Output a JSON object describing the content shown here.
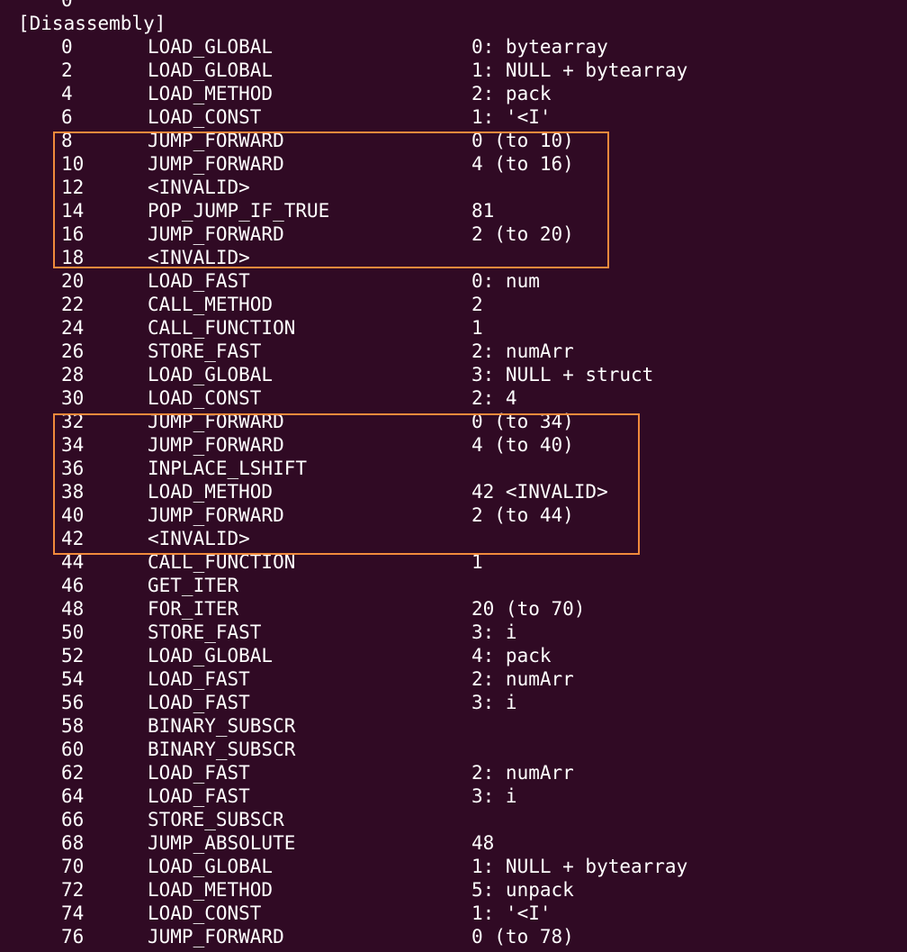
{
  "terminal": {
    "background": "#300a24",
    "text_color": "#ffffff",
    "highlight_color": "#f08a3c",
    "top_fragment": "0",
    "header": "[Disassembly]",
    "rows": [
      {
        "offset": "0",
        "opname": "LOAD_GLOBAL",
        "arg": "0: bytearray"
      },
      {
        "offset": "2",
        "opname": "LOAD_GLOBAL",
        "arg": "1: NULL + bytearray"
      },
      {
        "offset": "4",
        "opname": "LOAD_METHOD",
        "arg": "2: pack"
      },
      {
        "offset": "6",
        "opname": "LOAD_CONST",
        "arg": "1: '<I'"
      },
      {
        "offset": "8",
        "opname": "JUMP_FORWARD",
        "arg": "0 (to 10)"
      },
      {
        "offset": "10",
        "opname": "JUMP_FORWARD",
        "arg": "4 (to 16)"
      },
      {
        "offset": "12",
        "opname": "<INVALID>",
        "arg": ""
      },
      {
        "offset": "14",
        "opname": "POP_JUMP_IF_TRUE",
        "arg": "81"
      },
      {
        "offset": "16",
        "opname": "JUMP_FORWARD",
        "arg": "2 (to 20)"
      },
      {
        "offset": "18",
        "opname": "<INVALID>",
        "arg": ""
      },
      {
        "offset": "20",
        "opname": "LOAD_FAST",
        "arg": "0: num"
      },
      {
        "offset": "22",
        "opname": "CALL_METHOD",
        "arg": "2"
      },
      {
        "offset": "24",
        "opname": "CALL_FUNCTION",
        "arg": "1"
      },
      {
        "offset": "26",
        "opname": "STORE_FAST",
        "arg": "2: numArr"
      },
      {
        "offset": "28",
        "opname": "LOAD_GLOBAL",
        "arg": "3: NULL + struct"
      },
      {
        "offset": "30",
        "opname": "LOAD_CONST",
        "arg": "2: 4"
      },
      {
        "offset": "32",
        "opname": "JUMP_FORWARD",
        "arg": "0 (to 34)"
      },
      {
        "offset": "34",
        "opname": "JUMP_FORWARD",
        "arg": "4 (to 40)"
      },
      {
        "offset": "36",
        "opname": "INPLACE_LSHIFT",
        "arg": ""
      },
      {
        "offset": "38",
        "opname": "LOAD_METHOD",
        "arg": "42 <INVALID>"
      },
      {
        "offset": "40",
        "opname": "JUMP_FORWARD",
        "arg": "2 (to 44)"
      },
      {
        "offset": "42",
        "opname": "<INVALID>",
        "arg": ""
      },
      {
        "offset": "44",
        "opname": "CALL_FUNCTION",
        "arg": "1"
      },
      {
        "offset": "46",
        "opname": "GET_ITER",
        "arg": ""
      },
      {
        "offset": "48",
        "opname": "FOR_ITER",
        "arg": "20 (to 70)"
      },
      {
        "offset": "50",
        "opname": "STORE_FAST",
        "arg": "3: i"
      },
      {
        "offset": "52",
        "opname": "LOAD_GLOBAL",
        "arg": "4: pack"
      },
      {
        "offset": "54",
        "opname": "LOAD_FAST",
        "arg": "2: numArr"
      },
      {
        "offset": "56",
        "opname": "LOAD_FAST",
        "arg": "3: i"
      },
      {
        "offset": "58",
        "opname": "BINARY_SUBSCR",
        "arg": ""
      },
      {
        "offset": "60",
        "opname": "BINARY_SUBSCR",
        "arg": ""
      },
      {
        "offset": "62",
        "opname": "LOAD_FAST",
        "arg": "2: numArr"
      },
      {
        "offset": "64",
        "opname": "LOAD_FAST",
        "arg": "3: i"
      },
      {
        "offset": "66",
        "opname": "STORE_SUBSCR",
        "arg": ""
      },
      {
        "offset": "68",
        "opname": "JUMP_ABSOLUTE",
        "arg": "48"
      },
      {
        "offset": "70",
        "opname": "LOAD_GLOBAL",
        "arg": "1: NULL + bytearray"
      },
      {
        "offset": "72",
        "opname": "LOAD_METHOD",
        "arg": "5: unpack"
      },
      {
        "offset": "74",
        "opname": "LOAD_CONST",
        "arg": "1: '<I'"
      },
      {
        "offset": "76",
        "opname": "JUMP_FORWARD",
        "arg": "0 (to 78)"
      }
    ]
  }
}
